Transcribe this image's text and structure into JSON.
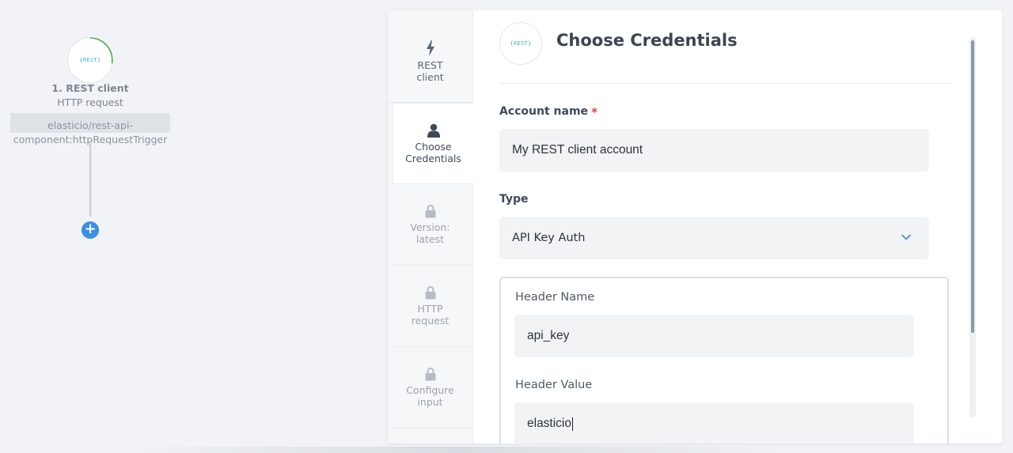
{
  "flow": {
    "node": {
      "logo_text": "{REST}",
      "title": "1. REST client",
      "subtitle": "HTTP request",
      "component_id_line1": "elasticio/rest-api-",
      "component_id_line2": "component:httpRequestTrigger"
    },
    "add_button": "+"
  },
  "steps": [
    {
      "line1": "REST",
      "line2": "client",
      "icon": "lightning-icon",
      "state": "done"
    },
    {
      "line1": "Choose",
      "line2": "Credentials",
      "icon": "user-icon",
      "state": "active"
    },
    {
      "line1": "Version:",
      "line2": "latest",
      "icon": "lock-icon",
      "state": "locked"
    },
    {
      "line1": "HTTP",
      "line2": "request",
      "icon": "lock-icon",
      "state": "locked"
    },
    {
      "line1": "Configure",
      "line2": "input",
      "icon": "lock-icon",
      "state": "locked"
    }
  ],
  "credentials": {
    "logo_text": "{REST}",
    "title": "Choose Credentials",
    "account_name_label": "Account name",
    "required_mark": "*",
    "account_name_value": "My REST client account",
    "type_label": "Type",
    "type_value": "API Key Auth",
    "header_name_label": "Header Name",
    "header_name_value": "api_key",
    "header_value_label": "Header Value",
    "header_value_value": "elasticio"
  },
  "colors": {
    "accent": "#3c8ee6",
    "teal_logo": "#3ab0c9",
    "required": "#e2413b",
    "progress_ring": "#4caf50"
  }
}
